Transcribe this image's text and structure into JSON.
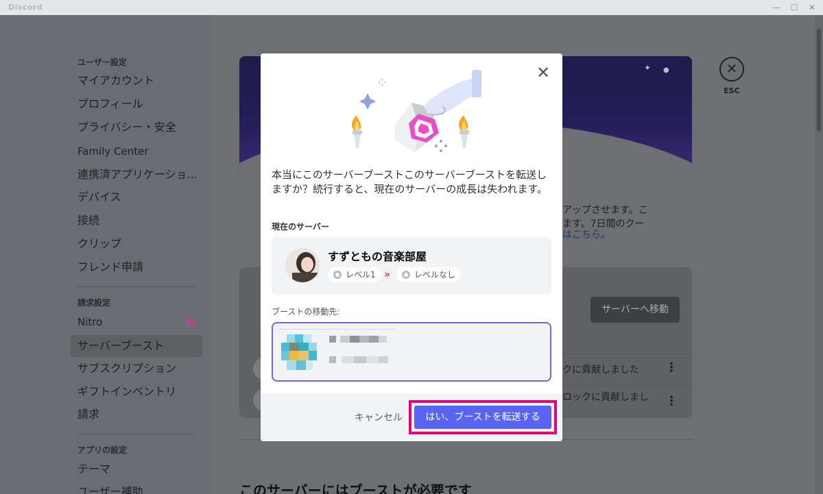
{
  "window": {
    "app_title": "Discord",
    "minimize_glyph": "—",
    "maximize_glyph": "☐",
    "close_glyph": "✕"
  },
  "sidebar": {
    "user_settings_header": "ユーザー設定",
    "user_items": [
      {
        "label": "マイアカウント"
      },
      {
        "label": "プロフィール"
      },
      {
        "label": "プライバシー・安全"
      },
      {
        "label": "Family Center"
      },
      {
        "label": "連携済アプリケーショ..."
      },
      {
        "label": "デバイス"
      },
      {
        "label": "接続"
      },
      {
        "label": "クリップ"
      },
      {
        "label": "フレンド申請"
      }
    ],
    "billing_header": "請求設定",
    "billing_items": [
      {
        "label": "Nitro"
      },
      {
        "label": "サーバーブースト"
      },
      {
        "label": "サブスクリプション"
      },
      {
        "label": "ギフトインベントリ"
      },
      {
        "label": "請求"
      }
    ],
    "app_settings_header": "アプリの設定",
    "app_items": [
      {
        "label": "テーマ"
      },
      {
        "label": "ユーザー補助"
      }
    ],
    "active_item": "サーバーブースト"
  },
  "background": {
    "esc_label": "ESC",
    "esc_glyph": "✕",
    "text_line1": "アップさせます。こ",
    "text_line2": "ます。7日間のクー",
    "text_link": "はこちら。",
    "goto_server_button": "サーバーへ移動",
    "row1_text": "クに貢献しました",
    "row2_text": "ロックに貢献しまし",
    "kebab_glyph": "⋮",
    "bottom_heading": "このサーバーにはブーストが必要です"
  },
  "modal": {
    "close_glyph": "✕",
    "description": "本当にこのサーバーブーストこのサーバーブーストを転送しますか？続行すると、現在のサーバーの成長は失われます。",
    "current_server_label": "現在のサーバー",
    "current_server": {
      "name": "すずともの音楽部屋",
      "level_from": "レベル1",
      "level_to": "レベルなし",
      "arrows": "»"
    },
    "target_label": "ブーストの移動先:",
    "cancel_label": "キャンセル",
    "confirm_label": "はい、ブーストを転送する"
  },
  "colors": {
    "brand": "#5865f2",
    "highlight": "#e4007f",
    "target_border": "#7b61d6",
    "nitro_pink": "#d63a9a"
  }
}
